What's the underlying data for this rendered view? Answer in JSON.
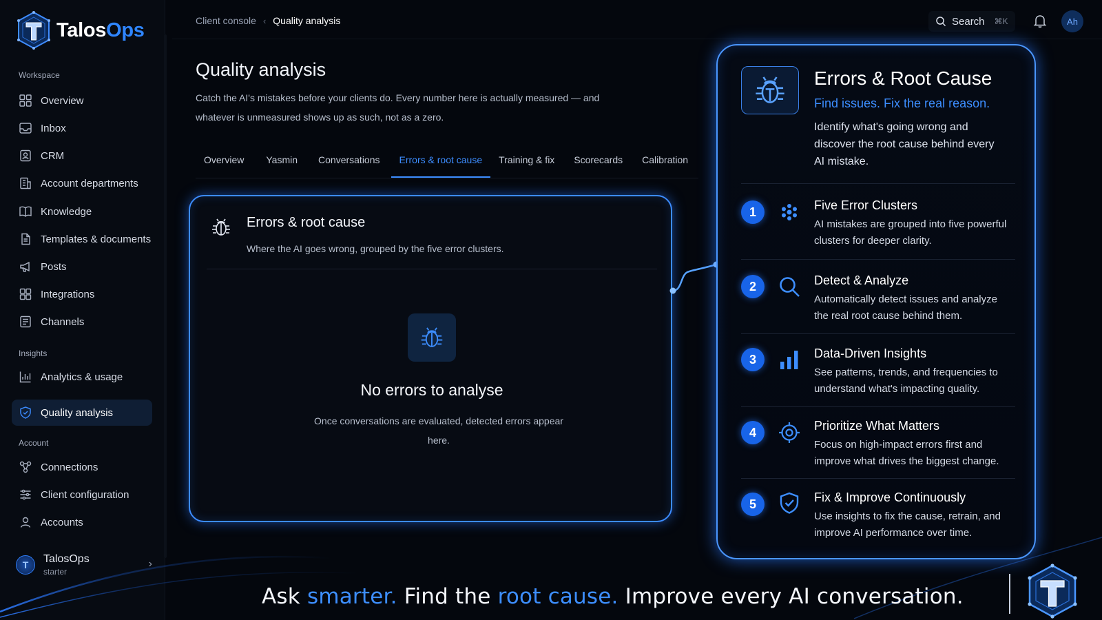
{
  "brand": {
    "name_part1": "Talos",
    "name_part2": "Ops"
  },
  "sidebar": {
    "sections": [
      {
        "label": "Workspace"
      },
      {
        "label": "Insights"
      },
      {
        "label": "Account"
      }
    ],
    "items": [
      {
        "label": "Overview",
        "icon": "grid-icon"
      },
      {
        "label": "Inbox",
        "icon": "inbox-icon"
      },
      {
        "label": "CRM",
        "icon": "crm-icon"
      },
      {
        "label": "Account departments",
        "icon": "building-icon"
      },
      {
        "label": "Knowledge",
        "icon": "book-icon"
      },
      {
        "label": "Templates & documents",
        "icon": "document-icon"
      },
      {
        "label": "Posts",
        "icon": "megaphone-icon"
      },
      {
        "label": "Integrations",
        "icon": "puzzle-icon"
      },
      {
        "label": "Channels",
        "icon": "channels-icon"
      },
      {
        "label": "Analytics & usage",
        "icon": "chart-icon"
      },
      {
        "label": "Quality analysis",
        "icon": "shield-icon",
        "active": true
      },
      {
        "label": "Connections",
        "icon": "connections-icon"
      },
      {
        "label": "Client configuration",
        "icon": "sliders-icon"
      },
      {
        "label": "Accounts",
        "icon": "user-icon"
      }
    ],
    "workspace": {
      "name": "TalosOps",
      "plan": "starter",
      "avatar_letter": "T"
    }
  },
  "topbar": {
    "breadcrumb_parent": "Client console",
    "breadcrumb_current": "Quality analysis",
    "search_label": "Search",
    "search_shortcut": "⌘K",
    "avatar_initials": "Ah"
  },
  "main": {
    "title": "Quality analysis",
    "description": "Catch the AI's mistakes before your clients do. Every number here is actually measured — and whatever is unmeasured shows up as such, not as a zero.",
    "tabs": [
      {
        "label": "Overview"
      },
      {
        "label": "Yasmin"
      },
      {
        "label": "Conversations"
      },
      {
        "label": "Errors & root cause",
        "active": true
      },
      {
        "label": "Training & fix"
      },
      {
        "label": "Scorecards"
      },
      {
        "label": "Calibration"
      }
    ],
    "card": {
      "title": "Errors & root cause",
      "subtitle": "Where the AI goes wrong, grouped by the five error clusters.",
      "empty_title": "No errors to analyse",
      "empty_text": "Once conversations are evaluated, detected errors appear here."
    }
  },
  "promo": {
    "title": "Errors & Root Cause",
    "tagline": "Find issues. Fix the real reason.",
    "description": "Identify what's going wrong and discover the root cause behind every AI mistake.",
    "features": [
      {
        "num": "1",
        "title": "Five Error Clusters",
        "desc": "AI mistakes are grouped into five powerful clusters for deeper clarity.",
        "icon": "cluster-dots-icon"
      },
      {
        "num": "2",
        "title": "Detect & Analyze",
        "desc": "Automatically detect issues and analyze the real root cause behind them.",
        "icon": "magnifier-icon"
      },
      {
        "num": "3",
        "title": "Data-Driven Insights",
        "desc": "See patterns, trends, and frequencies to understand what's impacting quality.",
        "icon": "bar-chart-icon"
      },
      {
        "num": "4",
        "title": "Prioritize What Matters",
        "desc": "Focus on high-impact errors first and improve what drives the biggest change.",
        "icon": "target-icon"
      },
      {
        "num": "5",
        "title": "Fix & Improve Continuously",
        "desc": "Use insights to fix the cause, retrain, and improve AI performance over time.",
        "icon": "shield-check-icon"
      }
    ]
  },
  "banner": {
    "part1": "Ask ",
    "hl1": "smarter.",
    "part2": " Find the ",
    "hl2": "root cause.",
    "part3": " Improve every AI conversation."
  },
  "colors": {
    "accent": "#3d8eff",
    "background": "#04070d",
    "active_nav": "#0f1e34"
  }
}
